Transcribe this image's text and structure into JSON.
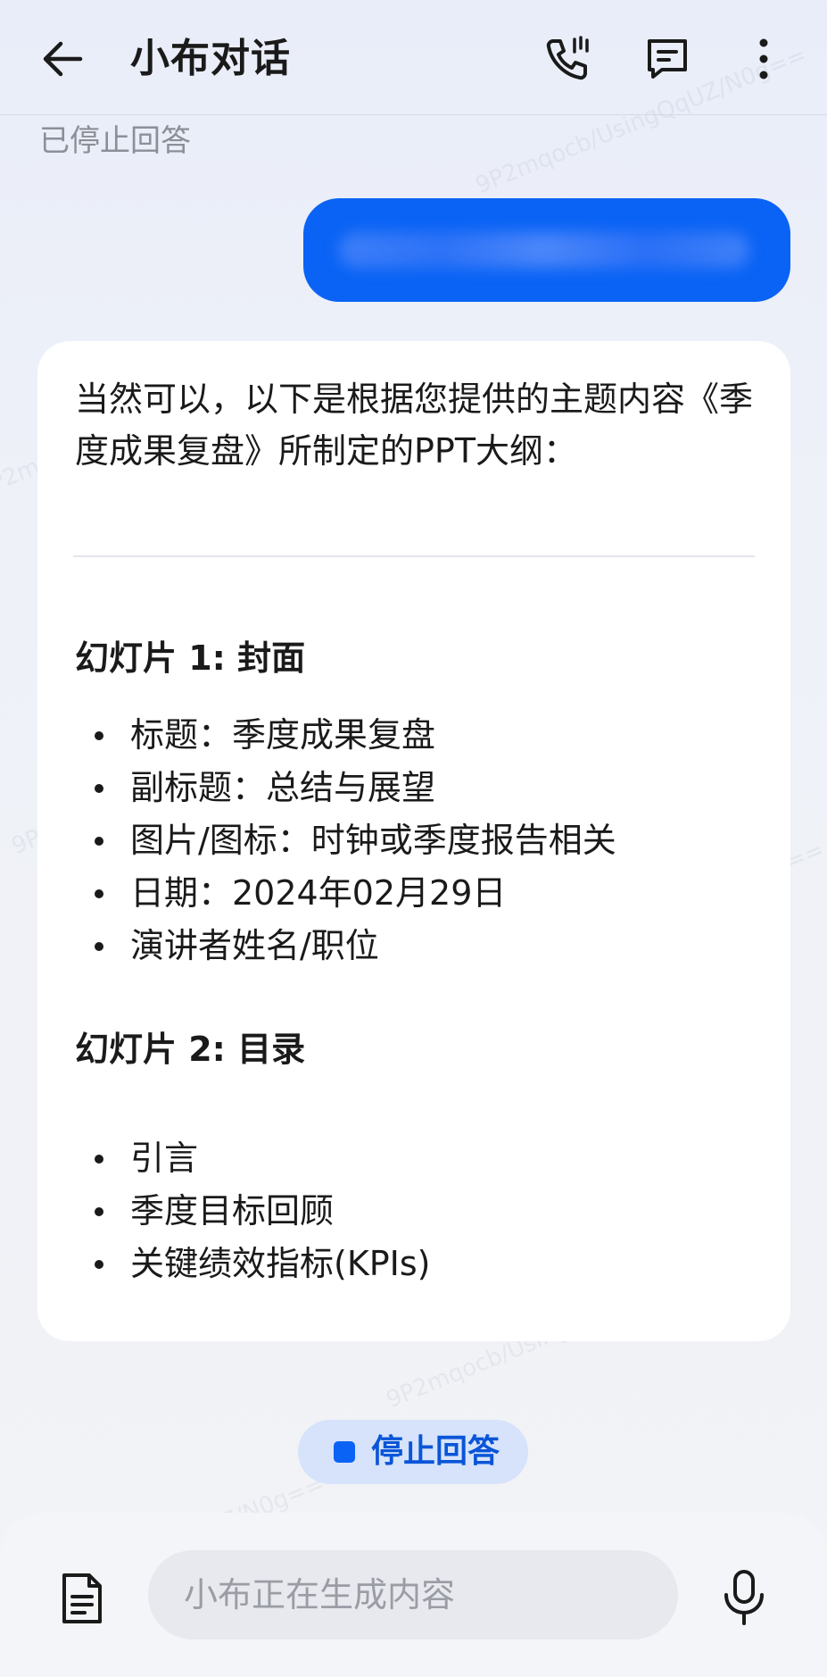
{
  "header": {
    "title": "小布对话",
    "back_icon": "arrow-left-icon",
    "call_icon": "phone-call-icon",
    "message_icon": "message-icon",
    "more_icon": "more-vertical-icon"
  },
  "status": {
    "stopped_text": "已停止回答"
  },
  "user_message": {
    "text": "（已模糊处理）",
    "color": "#0a63f5"
  },
  "response": {
    "intro": "当然可以，以下是根据您提供的主题内容《季度成果复盘》所制定的PPT大纲：",
    "slides": [
      {
        "title": "幻灯片 1: 封面",
        "bullets": [
          "标题：季度成果复盘",
          "副标题：总结与展望",
          "图片/图标：时钟或季度报告相关",
          "日期：2024年02月29日",
          "演讲者姓名/职位"
        ]
      },
      {
        "title": "幻灯片 2: 目录",
        "bullets": [
          "引言",
          "季度目标回顾",
          "关键绩效指标(KPIs)"
        ]
      }
    ]
  },
  "stop_button": {
    "label": "停止回答"
  },
  "input": {
    "placeholder": "小布正在生成内容",
    "doc_icon": "document-icon",
    "mic_icon": "microphone-icon"
  },
  "watermark": "9P2mqocb/UsingQqUZ/N0g==",
  "colors": {
    "accent": "#0a63f5",
    "accent_light": "#d6e3fb"
  }
}
